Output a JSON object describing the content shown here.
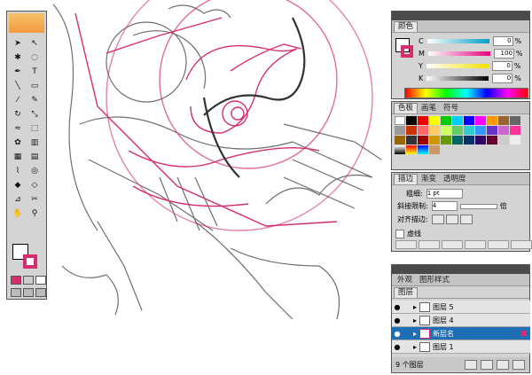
{
  "color_panel": {
    "title": "颜色",
    "channels": [
      {
        "label": "C",
        "value": "0",
        "unit": "%",
        "color": "#00a0c6"
      },
      {
        "label": "M",
        "value": "100",
        "unit": "%",
        "color": "#e6007e"
      },
      {
        "label": "Y",
        "value": "0",
        "unit": "%",
        "color": "#f2e100"
      },
      {
        "label": "K",
        "value": "0",
        "unit": "%",
        "color": "#000000"
      }
    ]
  },
  "swatches_panel": {
    "tabs": [
      "色板",
      "画笔",
      "符号"
    ]
  },
  "stroke_panel": {
    "tabs": [
      "描边",
      "渐变",
      "透明度"
    ],
    "weight_label": "粗细:",
    "weight_value": "1 pt",
    "miter_label": "斜接限制:",
    "miter_value": "4",
    "miter_unit": "倍",
    "align_label": "对齐描边:",
    "dashed_label": "虚线"
  },
  "layers_panel": {
    "tabs": [
      "外观",
      "图形样式"
    ],
    "sub_tab": "图层",
    "layers": [
      {
        "name": "图层 5",
        "selected": false
      },
      {
        "name": "图层 4",
        "selected": false
      },
      {
        "name": "新层名",
        "selected": true
      },
      {
        "name": "图层 1",
        "selected": false
      }
    ],
    "footer": "9 个图层"
  },
  "accent": {
    "stroke": "#d62d72",
    "selection": "#1f6fb7"
  }
}
